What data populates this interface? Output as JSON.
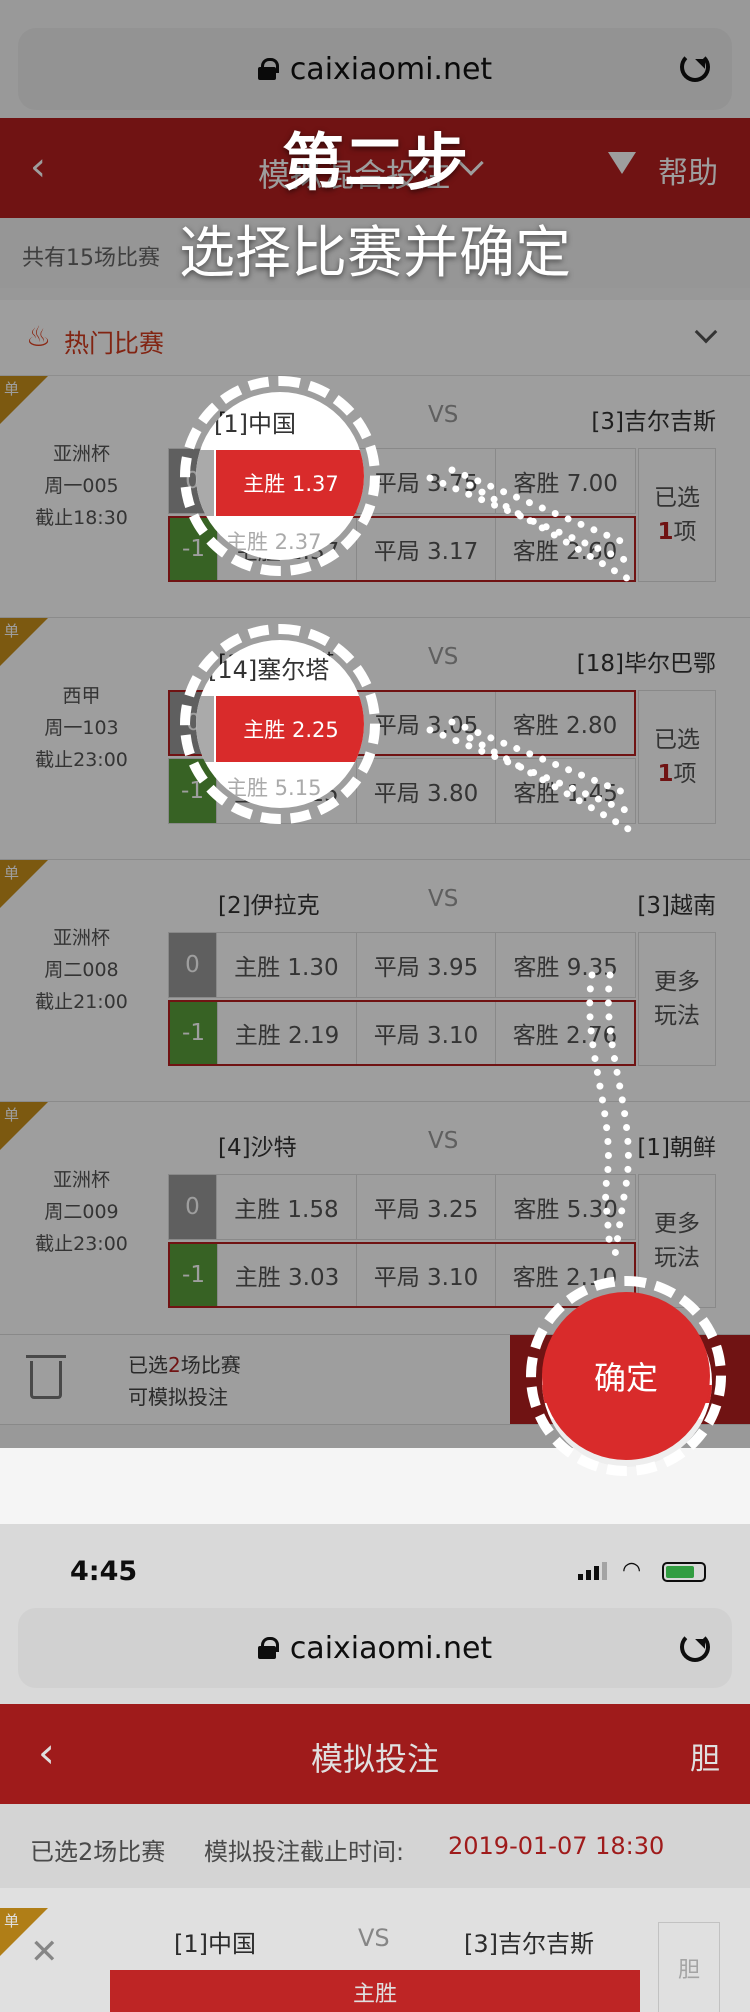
{
  "top": {
    "url": "caixiaomi.net",
    "nav_title": "模拟混合投注",
    "help": "帮助",
    "count_text": "共有15场比赛",
    "hot_label": "热门比赛"
  },
  "overlay": {
    "step": "第二步",
    "instruction": "选择比赛并确定"
  },
  "matches": [
    {
      "league": "亚洲杯",
      "week": "周一005",
      "deadline": "截止18:30",
      "home": "[1]中国",
      "vs": "VS",
      "away": "[3]吉尔吉斯",
      "r1": {
        "hc": "0",
        "w": "主胜 1.37",
        "d": "平局 3.75",
        "l": "客胜 7.00"
      },
      "r2": {
        "hc": "-1",
        "w": "主胜 2.37",
        "d": "平局 3.17",
        "l": "客胜 2.60"
      },
      "side_line1": "已选",
      "side_num": "1",
      "side_line2": "项",
      "tag": "单"
    },
    {
      "league": "西甲",
      "week": "周一103",
      "deadline": "截止23:00",
      "home": "[14]塞尔塔",
      "vs": "VS",
      "away": "[18]毕尔巴鄂",
      "r1": {
        "hc": "0",
        "w": "主胜 2.25",
        "d": "平局 3.05",
        "l": "客胜 2.80"
      },
      "r2": {
        "hc": "-1",
        "w": "主胜 5.15",
        "d": "平局 3.80",
        "l": "客胜 1.45"
      },
      "side_line1": "已选",
      "side_num": "1",
      "side_line2": "项",
      "tag": "单"
    },
    {
      "league": "亚洲杯",
      "week": "周二008",
      "deadline": "截止21:00",
      "home": "[2]伊拉克",
      "vs": "VS",
      "away": "[3]越南",
      "r1": {
        "hc": "0",
        "w": "主胜 1.30",
        "d": "平局 3.95",
        "l": "客胜 9.35"
      },
      "r2": {
        "hc": "-1",
        "w": "主胜 2.19",
        "d": "平局 3.10",
        "l": "客胜 2.76"
      },
      "side_line1": "更多",
      "side_num": "",
      "side_line2": "玩法",
      "tag": "单"
    },
    {
      "league": "亚洲杯",
      "week": "周二009",
      "deadline": "截止23:00",
      "home": "[4]沙特",
      "vs": "VS",
      "away": "[1]朝鲜",
      "r1": {
        "hc": "0",
        "w": "主胜 1.58",
        "d": "平局 3.25",
        "l": "客胜 5.30"
      },
      "r2": {
        "hc": "-1",
        "w": "主胜 3.03",
        "d": "平局 3.10",
        "l": "客胜 2.10"
      },
      "side_line1": "更多",
      "side_num": "",
      "side_line2": "玩法",
      "tag": "单"
    }
  ],
  "footer": {
    "line1_pre": "已选",
    "line1_num": "2",
    "line1_post": "场比赛",
    "line2": "可模拟投注",
    "confirm": "确定"
  },
  "status": {
    "time": "4:45"
  },
  "bottom": {
    "url": "caixiaomi.net",
    "nav_title": "模拟投注",
    "nav_right": "胆",
    "info_left": "已选2场比赛",
    "info_mid": "模拟投注截止时间:",
    "info_date": "2019-01-07 18:30",
    "home": "[1]中国",
    "vs": "VS",
    "away": "[3]吉尔吉斯",
    "pick": "主胜",
    "side": "胆",
    "tag": "单"
  },
  "colors": {
    "brand_red": "#b51f1f",
    "pick_red": "#d92b2b",
    "handicap_green": "#5a9e3a",
    "handicap_gray": "#9a9a9a",
    "tag_gold": "#c9901b"
  }
}
